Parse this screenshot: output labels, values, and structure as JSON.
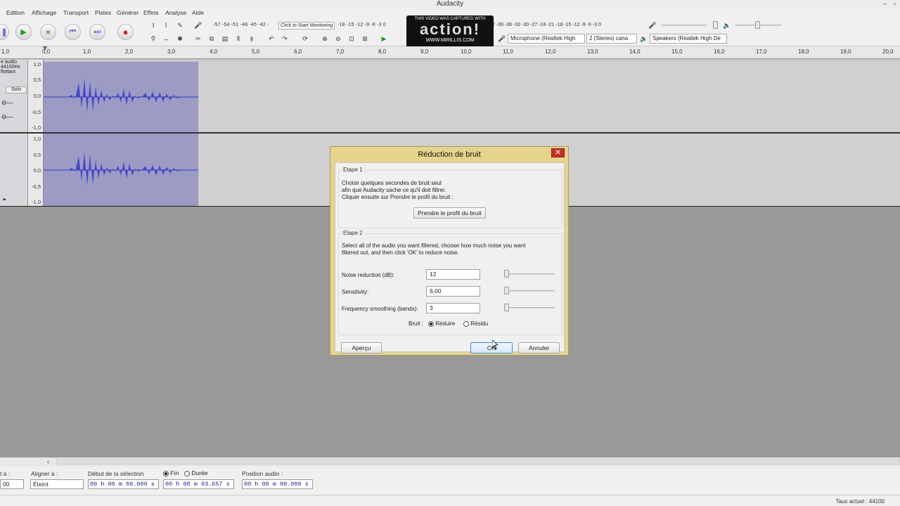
{
  "window": {
    "title": "Audacity"
  },
  "menu": [
    "Edition",
    "Affichage",
    "Transport",
    "Pistes",
    "Générer",
    "Effets",
    "Analyse",
    "Aide"
  ],
  "toolbar": {
    "meter_scale_left": "-57 -54 -51 -48 -45 -42 -",
    "monitor_label": "Click to Start Monitoring",
    "meter_scale_mid": "-18 -15 -12 -9 -6 -3 0",
    "meter_scale_right": "2 -39 -36 -33 -30 -27 -24 -21 -18 -15 -12 -9 -6 -3 0",
    "input_device": "Microphone (Realtek High",
    "channels": "2 (Stereo) cana",
    "output_device": "Speakers (Realtek High De"
  },
  "watermark": {
    "line1": "THIS VIDEO WAS CAPTURED WITH",
    "line2": "action!",
    "line3": "WWW.MIRILLIS.COM"
  },
  "ruler": [
    "1,0",
    "0,0",
    "1,0",
    "2,0",
    "3,0",
    "4,0",
    "5,0",
    "6,0",
    "7,0",
    "8,0",
    "9,0",
    "10,0",
    "11,0",
    "12,0",
    "13,0",
    "14,0",
    "15,0",
    "16,0",
    "17,0",
    "18,0",
    "19,0",
    "20,0"
  ],
  "track": {
    "name": "e audio",
    "rate": "44100Hz",
    "format": "flottant",
    "solo": "Solo",
    "scale": [
      "1,0",
      "0,5",
      "0,0",
      "-0,5",
      "-1,0"
    ]
  },
  "dialog": {
    "title": "Réduction de bruit",
    "close": "✕",
    "step1_title": "Etape 1",
    "step1_line1": "Choisir quelques secondes de bruit seul",
    "step1_line2": "afin que Audacity sache ce qu'il doit filtrer.",
    "step1_line3": "Cliquer ensuite sur Prendre le profil du bruit :",
    "profile_button": "Prendre le profil du bruit",
    "step2_title": "Etape 2",
    "step2_line1": "Select all of the audio you want filtered, choose how much noise you want",
    "step2_line2": "filtered out, and then click 'OK' to reduce noise.",
    "noise_reduction_label": "Noise reduction (dB):",
    "noise_reduction_value": "12",
    "sensitivity_label": "Sensitivity:",
    "sensitivity_value": "6,00",
    "smoothing_label": "Frequency smoothing (bands):",
    "smoothing_value": "3",
    "noise_label": "Bruit :",
    "reduce_option": "Réduire",
    "residue_option": "Résidu",
    "preview_button": "Aperçu",
    "ok_button": "OK",
    "cancel_button": "Annuler"
  },
  "selection_bar": {
    "rate_label": "t à :",
    "rate_value": "00",
    "snap_label": "Aligner à :",
    "snap_value": "Éteint",
    "start_label": "Début de la sélection",
    "end_option": "Fin",
    "length_option": "Durée",
    "start_time": "00 h 00 m 00.000 s",
    "end_time": "00 h 00 m 03.657 s",
    "position_label": "Position audio :",
    "position_time": "00 h 00 m 00.000 s"
  },
  "status": {
    "rate": "Taux actuel : 44100"
  }
}
